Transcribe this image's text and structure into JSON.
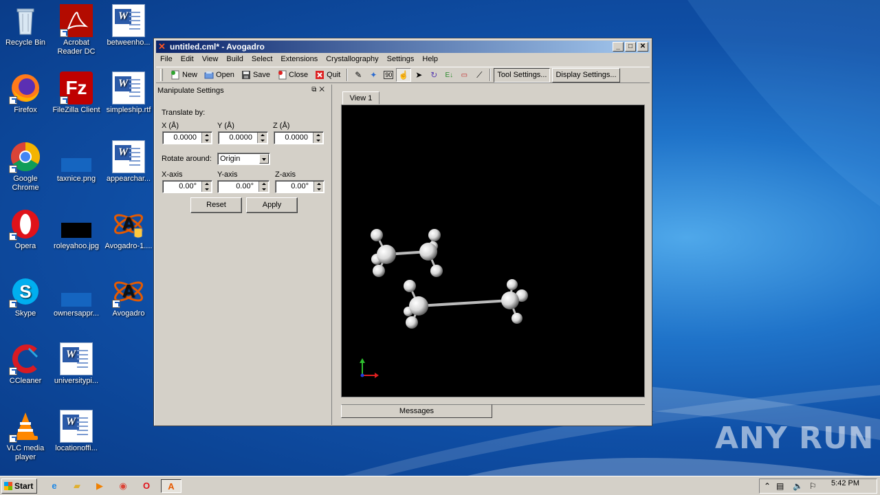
{
  "desktop": {
    "icons": [
      {
        "label": "Recycle Bin",
        "icon": "recycle-bin-icon"
      },
      {
        "label": "Acrobat Reader DC",
        "icon": "acrobat-icon"
      },
      {
        "label": "betweenho...",
        "icon": "word-doc-icon"
      },
      {
        "label": "Firefox",
        "icon": "firefox-icon"
      },
      {
        "label": "FileZilla Client",
        "icon": "filezilla-icon"
      },
      {
        "label": "simpleship.rtf",
        "icon": "word-doc-icon"
      },
      {
        "label": "Google Chrome",
        "icon": "chrome-icon"
      },
      {
        "label": "taxnice.png",
        "icon": "image-file-icon"
      },
      {
        "label": "appearchar...",
        "icon": "word-doc-icon"
      },
      {
        "label": "Opera",
        "icon": "opera-icon"
      },
      {
        "label": "roleyahoo.jpg",
        "icon": "image-file-icon"
      },
      {
        "label": "Avogadro-1....",
        "icon": "avogadro-icon"
      },
      {
        "label": "Skype",
        "icon": "skype-icon"
      },
      {
        "label": "ownersappr...",
        "icon": "image-file-icon"
      },
      {
        "label": "Avogadro",
        "icon": "avogadro-icon"
      },
      {
        "label": "CCleaner",
        "icon": "ccleaner-icon"
      },
      {
        "label": "universitypi...",
        "icon": "word-doc-icon"
      },
      {
        "label": "VLC media player",
        "icon": "vlc-icon"
      },
      {
        "label": "locationoffi...",
        "icon": "word-doc-icon"
      }
    ]
  },
  "window": {
    "title": "untitled.cml* - Avogadro",
    "menu": [
      "File",
      "Edit",
      "View",
      "Build",
      "Select",
      "Extensions",
      "Crystallography",
      "Settings",
      "Help"
    ],
    "toolbar": {
      "new": "New",
      "open": "Open",
      "save": "Save",
      "close": "Close",
      "quit": "Quit",
      "tool_settings": "Tool Settings...",
      "display_settings": "Display Settings..."
    },
    "panel": {
      "title": "Manipulate Settings",
      "translate_by": "Translate by:",
      "x_label": "X (Å)",
      "y_label": "Y (Å)",
      "z_label": "Z (Å)",
      "x_value": "0.0000",
      "y_value": "0.0000",
      "z_value": "0.0000",
      "rotate_around": "Rotate around:",
      "rotate_option": "Origin",
      "xaxis_label": "X-axis",
      "yaxis_label": "Y-axis",
      "zaxis_label": "Z-axis",
      "xaxis_value": "0.00°",
      "yaxis_value": "0.00°",
      "zaxis_value": "0.00°",
      "reset": "Reset",
      "apply": "Apply"
    },
    "view_tab": "View 1",
    "messages_tab": "Messages"
  },
  "taskbar": {
    "start": "Start",
    "clock": "5:42 PM"
  },
  "watermark": "ANY RUN"
}
